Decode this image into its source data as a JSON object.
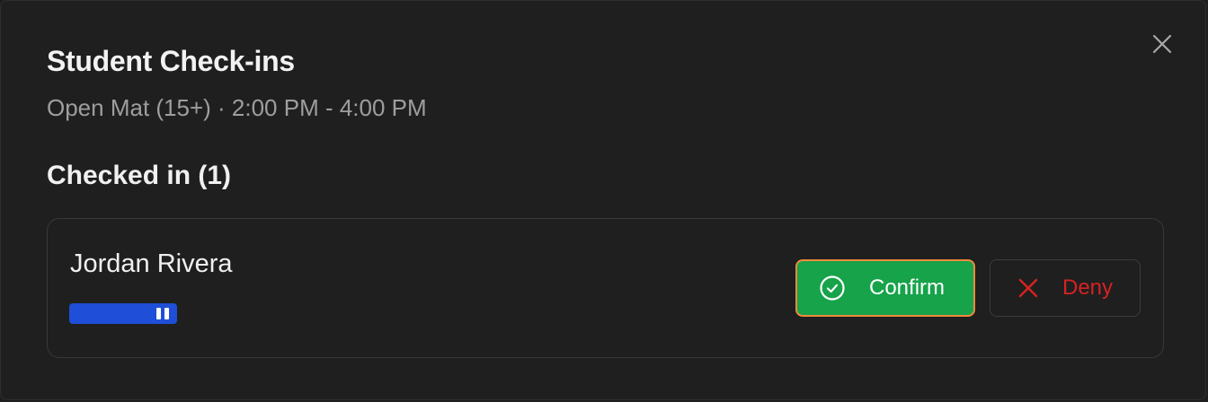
{
  "dialog": {
    "title": "Student Check-ins",
    "subtitle": "Open Mat (15+) · 2:00 PM - 4:00 PM",
    "close_icon": "close-icon"
  },
  "checked_in": {
    "heading": "Checked in (1)",
    "students": [
      {
        "name": "Jordan Rivera",
        "belt_color": "#1f4fd8",
        "belt_stripes": 2,
        "confirm_label": "Confirm",
        "deny_label": "Deny"
      }
    ]
  },
  "colors": {
    "confirm": "#16a34a",
    "confirm_border": "#f08a3c",
    "deny": "#d62222"
  }
}
